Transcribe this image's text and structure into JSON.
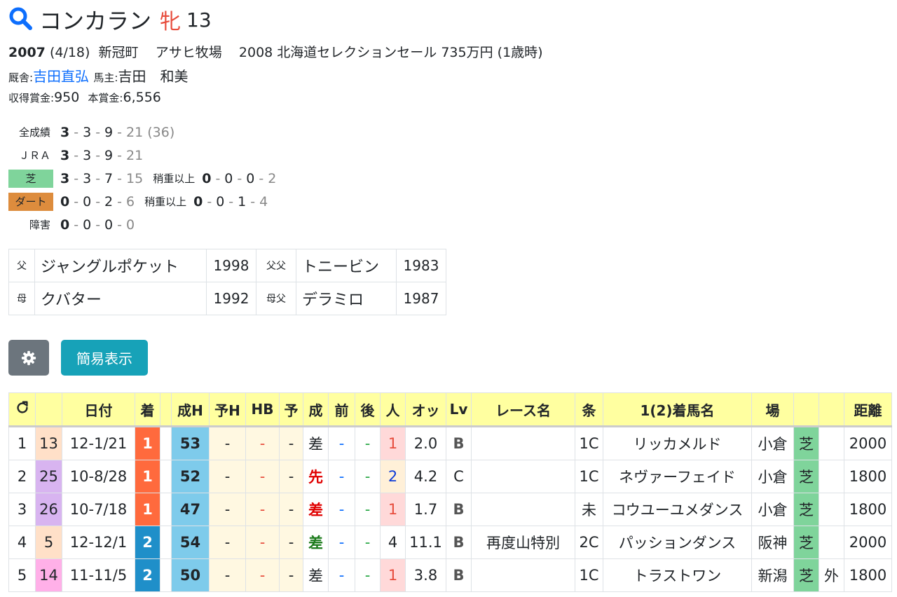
{
  "header": {
    "name": "コンカラン",
    "sex": "牝",
    "age": "13"
  },
  "profile": {
    "year": "2007",
    "date": "(4/18)",
    "birthplace": "新冠町",
    "breeder": "アサヒ牧場",
    "sale": "2008 北海道セレクションセール 735万円",
    "sale_age": "(1歳時)",
    "trainer_label": "厩舎:",
    "trainer": "吉田直弘",
    "owner_label": "馬主:",
    "owner": "吉田　和美",
    "earn_label": "収得賞金:",
    "earn": "950",
    "prize_label": "本賞金:",
    "prize": "6,556"
  },
  "stats": {
    "all": {
      "label": "全成績",
      "w": "3",
      "s": "3",
      "t": "9",
      "o": "21",
      "total": "(36)"
    },
    "jra": {
      "label": "ＪＲＡ",
      "w": "3",
      "s": "3",
      "t": "9",
      "o": "21"
    },
    "turf": {
      "label": "芝",
      "w": "3",
      "s": "3",
      "t": "7",
      "o": "15",
      "heavy_label": "稍重以上",
      "hw": "0",
      "hs": "0",
      "ht": "0",
      "ho": "2"
    },
    "dirt": {
      "label": "ダート",
      "w": "0",
      "s": "0",
      "t": "2",
      "o": "6",
      "heavy_label": "稍重以上",
      "hw": "0",
      "hs": "0",
      "ht": "1",
      "ho": "4"
    },
    "jump": {
      "label": "障害",
      "w": "0",
      "s": "0",
      "t": "0",
      "o": "0"
    }
  },
  "pedigree": [
    {
      "k1": "父",
      "n1": "ジャングルポケット",
      "y1": "1998",
      "k2": "父父",
      "n2": "トニービン",
      "y2": "1983"
    },
    {
      "k1": "母",
      "n1": "クバター",
      "y1": "1992",
      "k2": "母父",
      "n2": "デラミロ",
      "y2": "1987"
    }
  ],
  "buttons": {
    "settings_icon": "gear-icon",
    "simple": "簡易表示"
  },
  "table": {
    "headers": [
      "",
      "",
      "日付",
      "着",
      "",
      "成H",
      "予H",
      "HB",
      "予",
      "成",
      "前",
      "後",
      "人",
      "オッ",
      "Lv",
      "レース名",
      "条",
      "1(2)着馬名",
      "場",
      "",
      "",
      "距離"
    ],
    "rows": [
      {
        "no": "1",
        "n": "13",
        "nc": "#ffe0c8",
        "date": "12-1/21",
        "rank": "1",
        "rc": "#ff6a3d",
        "fig": "53",
        "yh": "-",
        "hb": "-",
        "yo": "-",
        "kyaku": "差",
        "kc": "#212529",
        "kb": false,
        "mae": "-",
        "ato": "-",
        "pop": "1",
        "pc": "#e74c3c",
        "pbg": "#ffd9d9",
        "odds": "2.0",
        "lv": "B",
        "lvb": true,
        "race": "",
        "cls": "1C",
        "winner": "リッカメルド",
        "venue": "小倉",
        "surf": "芝",
        "io": "",
        "dist": "2000"
      },
      {
        "no": "2",
        "n": "25",
        "nc": "#d8b4f0",
        "date": "10-8/28",
        "rank": "1",
        "rc": "#ff6a3d",
        "fig": "52",
        "yh": "-",
        "hb": "-",
        "yo": "-",
        "kyaku": "先",
        "kc": "#e00000",
        "kb": true,
        "mae": "-",
        "ato": "-",
        "pop": "2",
        "pc": "#0d3bd8",
        "pbg": "#fff0d8",
        "odds": "4.2",
        "lv": "C",
        "lvb": false,
        "race": "",
        "cls": "1C",
        "winner": "ネヴァーフェイド",
        "venue": "小倉",
        "surf": "芝",
        "io": "",
        "dist": "1800"
      },
      {
        "no": "3",
        "n": "26",
        "nc": "#d8b4f0",
        "date": "10-7/18",
        "rank": "1",
        "rc": "#ff6a3d",
        "fig": "47",
        "yh": "-",
        "hb": "-",
        "yo": "-",
        "kyaku": "差",
        "kc": "#e00000",
        "kb": true,
        "mae": "-",
        "ato": "-",
        "pop": "1",
        "pc": "#e74c3c",
        "pbg": "#ffd9d9",
        "odds": "1.7",
        "lv": "B",
        "lvb": true,
        "race": "",
        "cls": "未",
        "winner": "コウユーユメダンス",
        "venue": "小倉",
        "surf": "芝",
        "io": "",
        "dist": "1800"
      },
      {
        "no": "4",
        "n": "5",
        "nc": "#ffe0c8",
        "date": "12-12/1",
        "rank": "2",
        "rc": "#1f8fc9",
        "fig": "54",
        "yh": "-",
        "hb": "-",
        "yo": "-",
        "kyaku": "差",
        "kc": "#1a7a1a",
        "kb": true,
        "mae": "-",
        "ato": "-",
        "pop": "4",
        "pc": "#212529",
        "pbg": "#ffffff",
        "odds": "11.1",
        "lv": "B",
        "lvb": true,
        "race": "再度山特別",
        "cls": "2C",
        "winner": "パッションダンス",
        "venue": "阪神",
        "surf": "芝",
        "io": "",
        "dist": "2000"
      },
      {
        "no": "5",
        "n": "14",
        "nc": "#ffb0e8",
        "date": "11-11/5",
        "rank": "2",
        "rc": "#1f8fc9",
        "fig": "50",
        "yh": "-",
        "hb": "-",
        "yo": "-",
        "kyaku": "差",
        "kc": "#212529",
        "kb": false,
        "mae": "-",
        "ato": "-",
        "pop": "1",
        "pc": "#e74c3c",
        "pbg": "#ffd9d9",
        "odds": "3.8",
        "lv": "B",
        "lvb": true,
        "race": "",
        "cls": "1C",
        "winner": "トラストワン",
        "venue": "新潟",
        "surf": "芝",
        "io": "外",
        "dist": "1800"
      }
    ]
  }
}
